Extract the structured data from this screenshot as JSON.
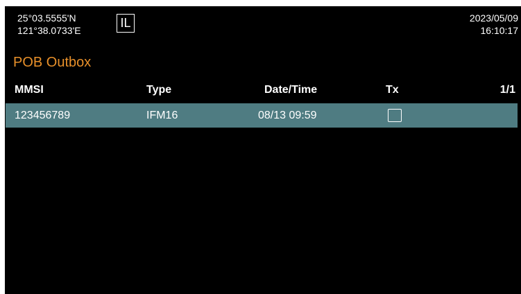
{
  "status_bar": {
    "latitude": "25°03.5555'N",
    "longitude": "121°38.0733'E",
    "mode": "IL",
    "date": "2023/05/09",
    "time": "16:10:17"
  },
  "page": {
    "title": "POB Outbox",
    "title_color": "#e8902a"
  },
  "table": {
    "columns": {
      "mmsi": "MMSI",
      "type": "Type",
      "datetime": "Date/Time",
      "tx": "Tx"
    },
    "page_indicator": "1/1",
    "rows": [
      {
        "mmsi": "123456789",
        "type": "IFM16",
        "datetime": "08/13 09:59",
        "tx_checked": false
      }
    ],
    "selected_row_color": "#4f7c82"
  }
}
